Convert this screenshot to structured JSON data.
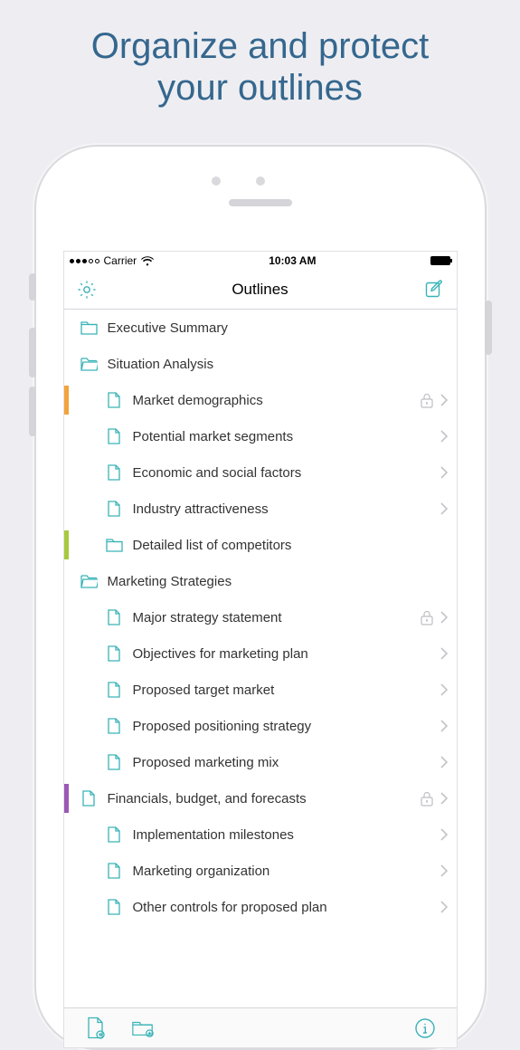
{
  "promo": {
    "line1": "Organize and protect",
    "line2": "your outlines"
  },
  "status": {
    "carrier": "Carrier",
    "time": "10:03 AM"
  },
  "nav": {
    "title": "Outlines"
  },
  "colors": {
    "accent": "#3ab3b8",
    "tag_orange": "#f2a33c",
    "tag_green": "#a7c93f",
    "tag_purple": "#9b59b6"
  },
  "rows": [
    {
      "type": "folder",
      "open": false,
      "indent": 0,
      "label": "Executive Summary",
      "tag": null,
      "locked": false,
      "chevron": false
    },
    {
      "type": "folder",
      "open": true,
      "indent": 0,
      "label": "Situation Analysis",
      "tag": null,
      "locked": false,
      "chevron": false
    },
    {
      "type": "file",
      "indent": 1,
      "label": "Market demographics",
      "tag": "orange",
      "locked": true,
      "chevron": true
    },
    {
      "type": "file",
      "indent": 1,
      "label": "Potential market segments",
      "tag": null,
      "locked": false,
      "chevron": true
    },
    {
      "type": "file",
      "indent": 1,
      "label": "Economic and social factors",
      "tag": null,
      "locked": false,
      "chevron": true
    },
    {
      "type": "file",
      "indent": 1,
      "label": "Industry attractiveness",
      "tag": null,
      "locked": false,
      "chevron": true
    },
    {
      "type": "folder",
      "open": false,
      "indent": 1,
      "label": "Detailed list of competitors",
      "tag": "green",
      "locked": false,
      "chevron": false
    },
    {
      "type": "folder",
      "open": true,
      "indent": 0,
      "label": "Marketing Strategies",
      "tag": null,
      "locked": false,
      "chevron": false
    },
    {
      "type": "file",
      "indent": 1,
      "label": "Major strategy statement",
      "tag": null,
      "locked": true,
      "chevron": true
    },
    {
      "type": "file",
      "indent": 1,
      "label": "Objectives for marketing plan",
      "tag": null,
      "locked": false,
      "chevron": true
    },
    {
      "type": "file",
      "indent": 1,
      "label": "Proposed target market",
      "tag": null,
      "locked": false,
      "chevron": true
    },
    {
      "type": "file",
      "indent": 1,
      "label": "Proposed positioning strategy",
      "tag": null,
      "locked": false,
      "chevron": true
    },
    {
      "type": "file",
      "indent": 1,
      "label": "Proposed marketing mix",
      "tag": null,
      "locked": false,
      "chevron": true
    },
    {
      "type": "file",
      "indent": 0,
      "label": "Financials, budget, and forecasts",
      "tag": "purple",
      "locked": true,
      "chevron": true
    },
    {
      "type": "file",
      "indent": 1,
      "label": "Implementation milestones",
      "tag": null,
      "locked": false,
      "chevron": true
    },
    {
      "type": "file",
      "indent": 1,
      "label": "Marketing organization",
      "tag": null,
      "locked": false,
      "chevron": true
    },
    {
      "type": "file",
      "indent": 1,
      "label": "Other controls for proposed plan",
      "tag": null,
      "locked": false,
      "chevron": true
    }
  ]
}
